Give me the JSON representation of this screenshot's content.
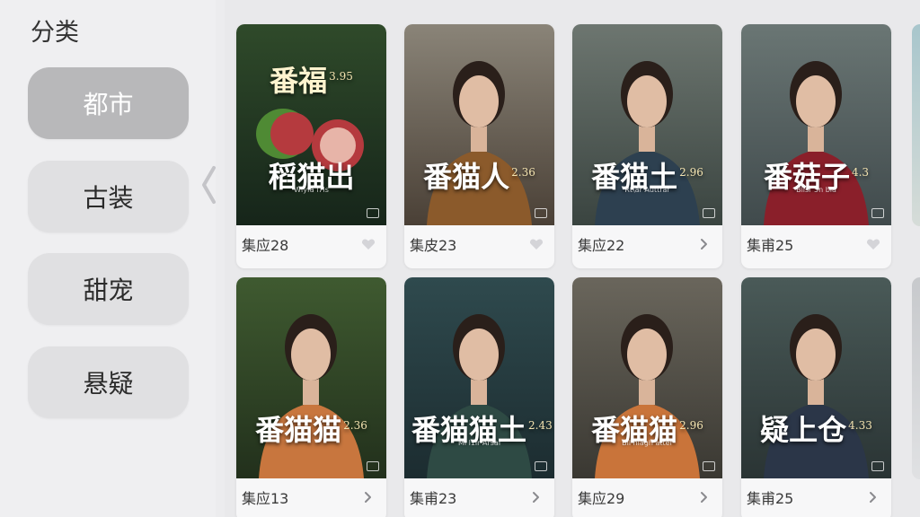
{
  "sidebar": {
    "title": "分类",
    "categories": [
      {
        "label": "都市",
        "active": true
      },
      {
        "label": "古装",
        "active": false
      },
      {
        "label": "甜宠",
        "active": false
      },
      {
        "label": "悬疑",
        "active": false
      }
    ],
    "collapse_icon": "chevron-left-icon"
  },
  "grid": {
    "cards": [
      {
        "title_top": "番福",
        "title_top_num": "3.95",
        "title": "稻猫出",
        "title_num": "",
        "subtitle": "Wlyfa l7ls",
        "episode": "集应28",
        "icon": "heart-icon",
        "colors": [
          "#2f4a2a",
          "#16251a",
          "#b53a3e"
        ]
      },
      {
        "title_top": "",
        "title_top_num": "",
        "title": "番猫人",
        "title_num": "2.36",
        "subtitle": "",
        "episode": "集皮23",
        "icon": "heart-icon",
        "colors": [
          "#8a8478",
          "#4a4036",
          "#8b5a2b"
        ]
      },
      {
        "title_top": "",
        "title_top_num": "",
        "title": "番猫土",
        "title_num": "2.96",
        "subtitle": "Rt\\ar Auttrar",
        "episode": "集应22",
        "icon": "chevron-right-icon",
        "colors": [
          "#6d7670",
          "#3a4440",
          "#2d4050"
        ]
      },
      {
        "title_top": "",
        "title_top_num": "",
        "title": "番菇子",
        "title_num": "4.3",
        "subtitle": "Bllsr 5n bla",
        "episode": "集甫25",
        "icon": "heart-icon",
        "colors": [
          "#6a7674",
          "#404a4c",
          "#8a1f2a"
        ]
      },
      {
        "title_top": "",
        "title_top_num": "",
        "title": "番猫猫",
        "title_num": "2.36",
        "subtitle": "",
        "episode": "集应13",
        "icon": "chevron-right-icon",
        "colors": [
          "#3f5a30",
          "#22301c",
          "#c8763e"
        ]
      },
      {
        "title_top": "",
        "title_top_num": "",
        "title": "番猫猫土",
        "title_num": "2.43",
        "subtitle": "Ml l1ir Arsal",
        "episode": "集甫23",
        "icon": "chevron-right-icon",
        "colors": [
          "#2f4a4e",
          "#1c2c30",
          "#2e4a44"
        ]
      },
      {
        "title_top": "",
        "title_top_num": "",
        "title": "番猫猫",
        "title_num": "2.96",
        "subtitle": "Bll hlagh atter",
        "episode": "集应29",
        "icon": "chevron-right-icon",
        "colors": [
          "#6a665c",
          "#3a3832",
          "#c9743a"
        ]
      },
      {
        "title_top": "",
        "title_top_num": "",
        "title": "疑上仓",
        "title_num": "4.33",
        "subtitle": "",
        "episode": "集甫25",
        "icon": "chevron-right-icon",
        "colors": [
          "#4a5a58",
          "#2a3434",
          "#2b3648"
        ]
      }
    ]
  }
}
